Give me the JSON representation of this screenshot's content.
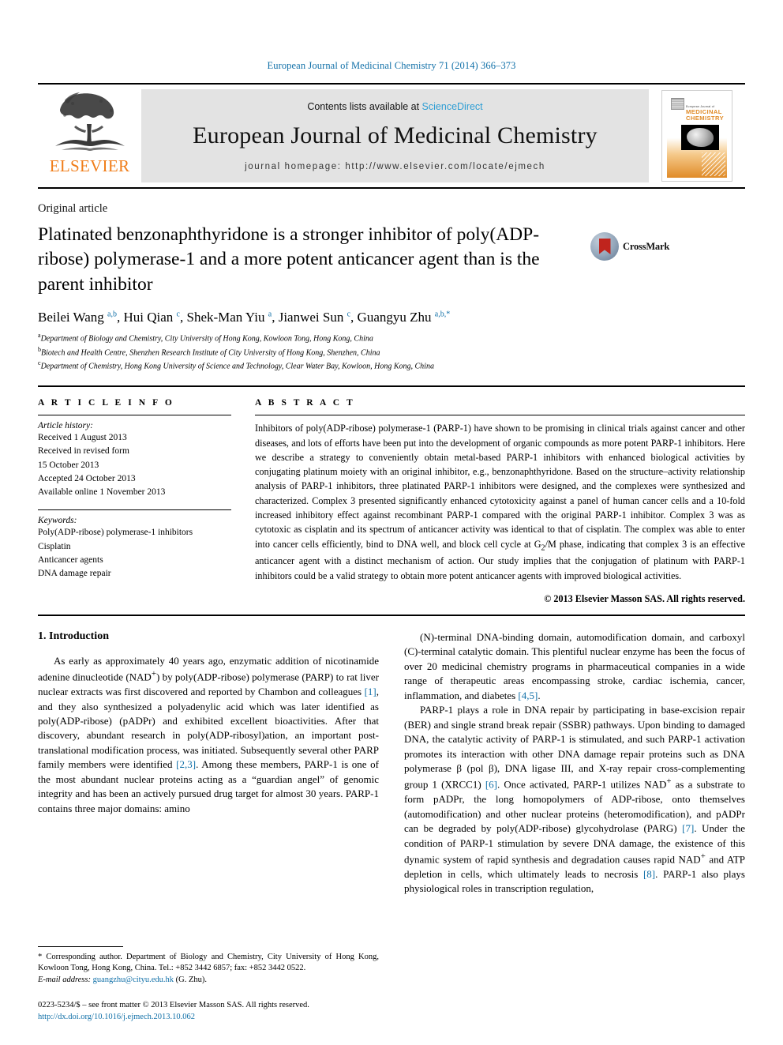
{
  "running_head": "European Journal of Medicinal Chemistry 71 (2014) 366–373",
  "masthead": {
    "publisher": "ELSEVIER",
    "contents_prefix": "Contents lists available at ",
    "contents_link": "ScienceDirect",
    "journal_title": "European Journal of Medicinal Chemistry",
    "homepage": "journal homepage: http://www.elsevier.com/locate/ejmech",
    "cover": {
      "eyebrow": "European Journal of",
      "line1": "MEDICINAL",
      "line2": "CHEMISTRY"
    }
  },
  "article": {
    "type": "Original article",
    "title": "Platinated benzonaphthyridone is a stronger inhibitor of poly(ADP-ribose) polymerase-1 and a more potent anticancer agent than is the parent inhibitor",
    "crossmark_label": "CrossMark",
    "authors_html": "Beilei Wang <sup>a,b</sup>, Hui Qian <sup>c</sup>, Shek-Man Yiu <sup>a</sup>, Jianwei Sun <sup>c</sup>, Guangyu Zhu <sup>a,b,*</sup>",
    "affiliations": [
      {
        "marker": "a",
        "text": "Department of Biology and Chemistry, City University of Hong Kong, Kowloon Tong, Hong Kong, China"
      },
      {
        "marker": "b",
        "text": "Biotech and Health Centre, Shenzhen Research Institute of City University of Hong Kong, Shenzhen, China"
      },
      {
        "marker": "c",
        "text": "Department of Chemistry, Hong Kong University of Science and Technology, Clear Water Bay, Kowloon, Hong Kong, China"
      }
    ]
  },
  "article_info": {
    "heading": "A R T I C L E   I N F O",
    "history_label": "Article history:",
    "history": [
      "Received 1 August 2013",
      "Received in revised form",
      "15 October 2013",
      "Accepted 24 October 2013",
      "Available online 1 November 2013"
    ],
    "keywords_label": "Keywords:",
    "keywords": [
      "Poly(ADP-ribose) polymerase-1 inhibitors",
      "Cisplatin",
      "Anticancer agents",
      "DNA damage repair"
    ]
  },
  "abstract": {
    "heading": "A B S T R A C T",
    "text": "Inhibitors of poly(ADP-ribose) polymerase-1 (PARP-1) have shown to be promising in clinical trials against cancer and other diseases, and lots of efforts have been put into the development of organic compounds as more potent PARP-1 inhibitors. Here we describe a strategy to conveniently obtain metal-based PARP-1 inhibitors with enhanced biological activities by conjugating platinum moiety with an original inhibitor, e.g., benzonaphthyridone. Based on the structure–activity relationship analysis of PARP-1 inhibitors, three platinated PARP-1 inhibitors were designed, and the complexes were synthesized and characterized. Complex 3 presented significantly enhanced cytotoxicity against a panel of human cancer cells and a 10-fold increased inhibitory effect against recombinant PARP-1 compared with the original PARP-1 inhibitor. Complex 3 was as cytotoxic as cisplatin and its spectrum of anticancer activity was identical to that of cisplatin. The complex was able to enter into cancer cells efficiently, bind to DNA well, and block cell cycle at G2/M phase, indicating that complex 3 is an effective anticancer agent with a distinct mechanism of action. Our study implies that the conjugation of platinum with PARP-1 inhibitors could be a valid strategy to obtain more potent anticancer agents with improved biological activities.",
    "copyright": "© 2013 Elsevier Masson SAS. All rights reserved."
  },
  "body": {
    "section_number_title": "1.  Introduction",
    "left_paragraphs": [
      "As early as approximately 40 years ago, enzymatic addition of nicotinamide adenine dinucleotide (NAD+) by poly(ADP-ribose) polymerase (PARP) to rat liver nuclear extracts was first discovered and reported by Chambon and colleagues [1], and they also synthesized a polyadenylic acid which was later identified as poly(ADP-ribose) (pADPr) and exhibited excellent bioactivities. After that discovery, abundant research in poly(ADP-ribosyl)ation, an important post-translational modification process, was initiated. Subsequently several other PARP family members were identified [2,3]. Among these members, PARP-1 is one of the most abundant nuclear proteins acting as a “guardian angel” of genomic integrity and has been an actively pursued drug target for almost 30 years. PARP-1 contains three major domains: amino"
    ],
    "right_paragraphs": [
      "(N)-terminal DNA-binding domain, automodification domain, and carboxyl (C)-terminal catalytic domain. This plentiful nuclear enzyme has been the focus of over 20 medicinal chemistry programs in pharmaceutical companies in a wide range of therapeutic areas encompassing stroke, cardiac ischemia, cancer, inflammation, and diabetes [4,5].",
      "PARP-1 plays a role in DNA repair by participating in base-excision repair (BER) and single strand break repair (SSBR) pathways. Upon binding to damaged DNA, the catalytic activity of PARP-1 is stimulated, and such PARP-1 activation promotes its interaction with other DNA damage repair proteins such as DNA polymerase β (pol β), DNA ligase III, and X-ray repair cross-complementing group 1 (XRCC1) [6]. Once activated, PARP-1 utilizes NAD+ as a substrate to form pADPr, the long homopolymers of ADP-ribose, onto themselves (automodification) and other nuclear proteins (heteromodification), and pADPr can be degraded by poly(ADP-ribose) glycohydrolase (PARG) [7]. Under the condition of PARP-1 stimulation by severe DNA damage, the existence of this dynamic system of rapid synthesis and degradation causes rapid NAD+ and ATP depletion in cells, which ultimately leads to necrosis [8]. PARP-1 also plays physiological roles in transcription regulation,"
    ]
  },
  "footnote": {
    "corresponding": "* Corresponding author. Department of Biology and Chemistry, City University of Hong Kong, Kowloon Tong, Hong Kong, China. Tel.: +852 3442 6857; fax: +852 3442 0522.",
    "email_label": "E-mail address:",
    "email": "guangzhu@cityu.edu.hk",
    "email_suffix": "(G. Zhu).",
    "frontmatter": "0223-5234/$ – see front matter © 2013 Elsevier Masson SAS. All rights reserved.",
    "doi": "http://dx.doi.org/10.1016/j.ejmech.2013.10.062"
  }
}
